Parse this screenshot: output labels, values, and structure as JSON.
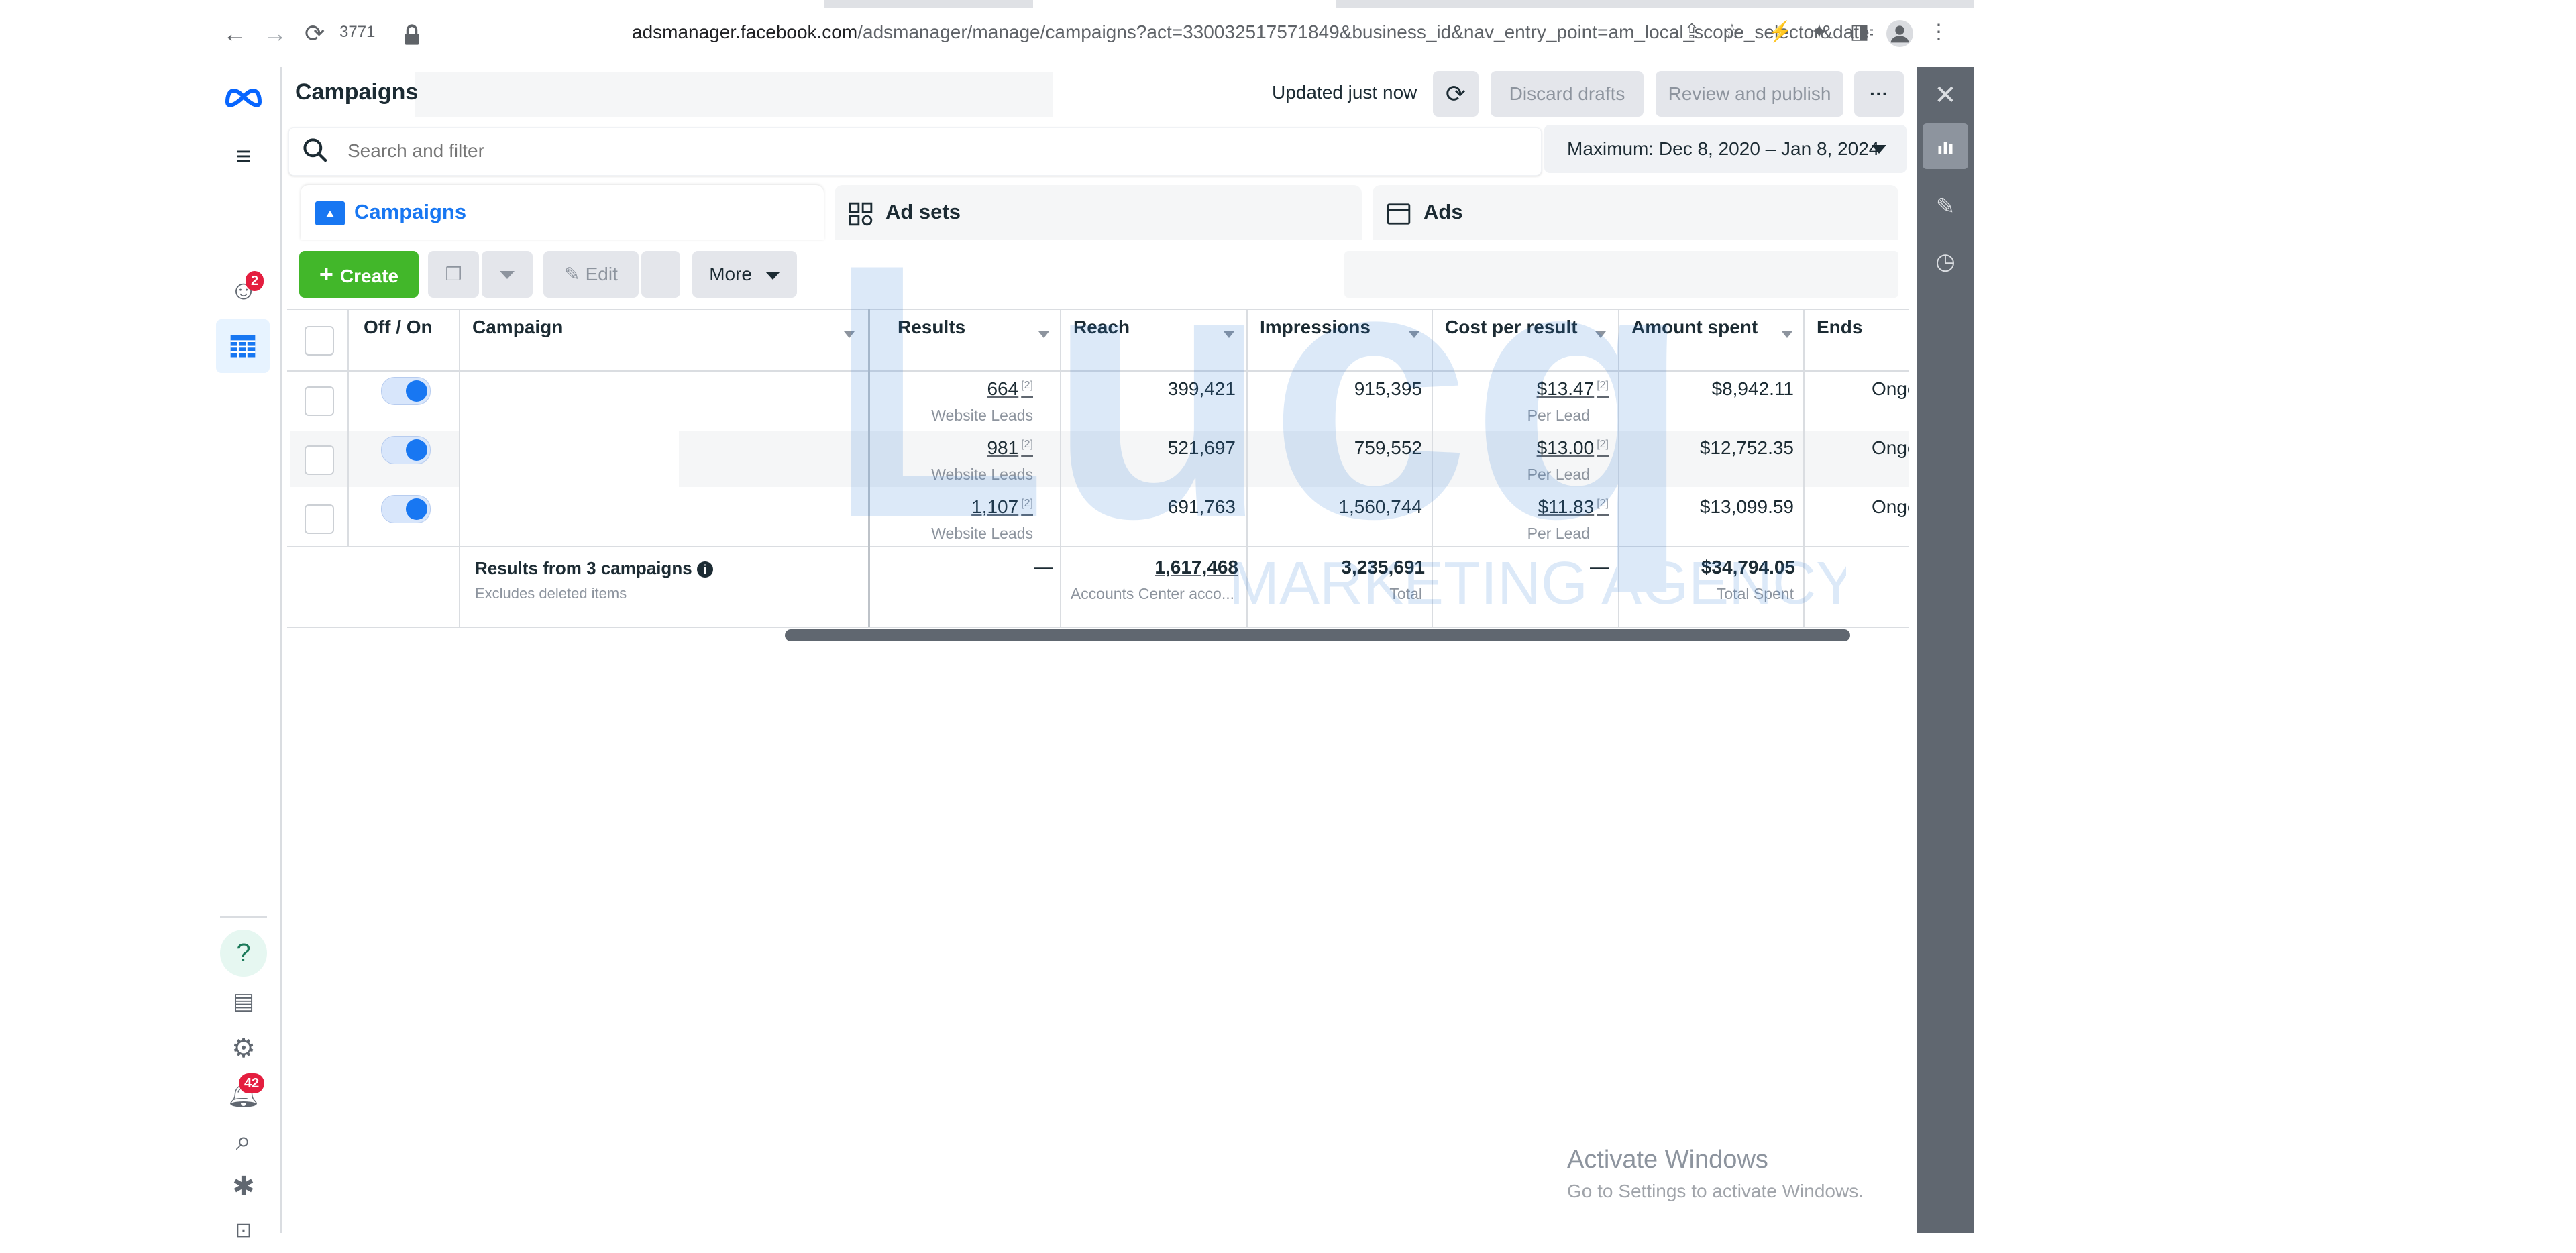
{
  "browser": {
    "tab_count": "3771",
    "url_domain": "adsmanager.facebook.com",
    "url_path": "/adsmanager/manage/campaigns?act=330032517571849&business_id&nav_entry_point=am_local_scope_selector&date=2020-1..."
  },
  "left_rail": {
    "adaccount_badge": "2",
    "notifications_badge": "42"
  },
  "header": {
    "title": "Campaigns",
    "updated": "Updated just now",
    "discard_label": "Discard drafts",
    "review_label": "Review and publish",
    "more_label": "···"
  },
  "search": {
    "placeholder": "Search and filter",
    "date_range": "Maximum: Dec 8, 2020 – Jan 8, 2024"
  },
  "tabs": {
    "campaigns": "Campaigns",
    "adsets": "Ad sets",
    "ads": "Ads"
  },
  "toolbar": {
    "create": "Create",
    "edit": "Edit",
    "more": "More"
  },
  "table": {
    "columns": {
      "off_on": "Off / On",
      "campaign": "Campaign",
      "results": "Results",
      "reach": "Reach",
      "impressions": "Impressions",
      "cost_per_result": "Cost per result",
      "amount_spent": "Amount spent",
      "ends": "Ends"
    },
    "rows": [
      {
        "results": "664",
        "results_sub": "Website Leads",
        "reach": "399,421",
        "impressions": "915,395",
        "cpr": "$13.47",
        "cpr_sub": "Per Lead",
        "spent": "$8,942.11",
        "ends": "Ongoing"
      },
      {
        "results": "981",
        "results_sub": "Website Leads",
        "reach": "521,697",
        "impressions": "759,552",
        "cpr": "$13.00",
        "cpr_sub": "Per Lead",
        "spent": "$12,752.35",
        "ends": "Ongoing"
      },
      {
        "results": "1,107",
        "results_sub": "Website Leads",
        "reach": "691,763",
        "impressions": "1,560,744",
        "cpr": "$11.83",
        "cpr_sub": "Per Lead",
        "spent": "$13,099.59",
        "ends": "Ongoing"
      }
    ],
    "footnote_mark": "[2]",
    "totals": {
      "label": "Results from 3 campaigns",
      "sublabel": "Excludes deleted items",
      "results": "—",
      "reach": "1,617,468",
      "reach_sub": "Accounts Center acco...",
      "impressions": "3,235,691",
      "impressions_sub": "Total",
      "cpr": "—",
      "spent": "$34,794.05",
      "spent_sub": "Total Spent"
    }
  },
  "watermark": {
    "wordmark": "Lucq",
    "tagline": "MARKETING AGENCY"
  },
  "windows_notice": {
    "line1": "Activate Windows",
    "line2": "Go to Settings to activate Windows."
  },
  "colors": {
    "brand_blue": "#1877f2",
    "create_green": "#42b72a",
    "rail_gray": "#606770",
    "badge_red": "#e41e3f"
  }
}
